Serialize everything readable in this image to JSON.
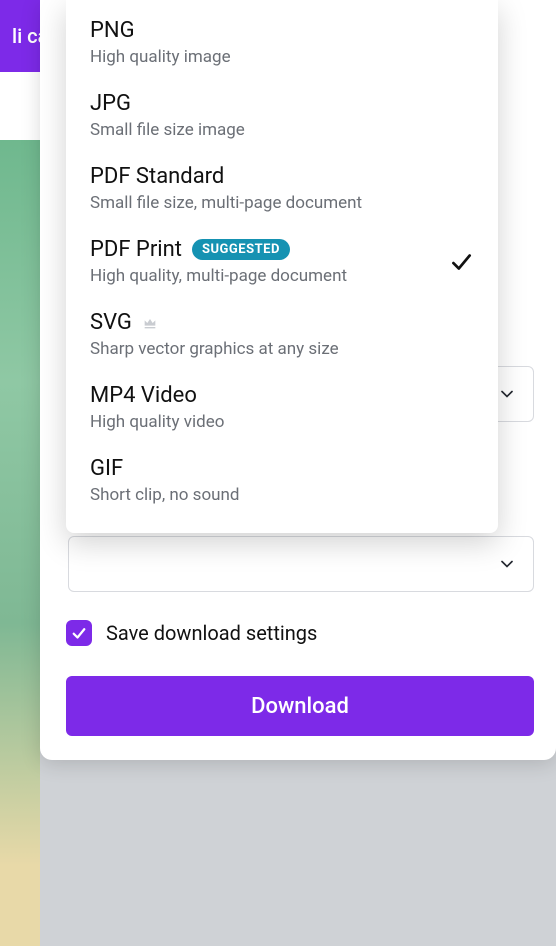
{
  "header": {
    "title": "li card"
  },
  "save_settings_label": "Save download settings",
  "download_label": "Download",
  "file_types": [
    {
      "name": "PNG",
      "desc": "High quality image",
      "badge": null,
      "premium": false,
      "selected": false
    },
    {
      "name": "JPG",
      "desc": "Small file size image",
      "badge": null,
      "premium": false,
      "selected": false
    },
    {
      "name": "PDF Standard",
      "desc": "Small file size, multi-page document",
      "badge": null,
      "premium": false,
      "selected": false
    },
    {
      "name": "PDF Print",
      "desc": "High quality, multi-page document",
      "badge": "SUGGESTED",
      "premium": false,
      "selected": true
    },
    {
      "name": "SVG",
      "desc": "Sharp vector graphics at any size",
      "badge": null,
      "premium": true,
      "selected": false
    },
    {
      "name": "MP4 Video",
      "desc": "High quality video",
      "badge": null,
      "premium": false,
      "selected": false
    },
    {
      "name": "GIF",
      "desc": "Short clip, no sound",
      "badge": null,
      "premium": false,
      "selected": false
    }
  ]
}
